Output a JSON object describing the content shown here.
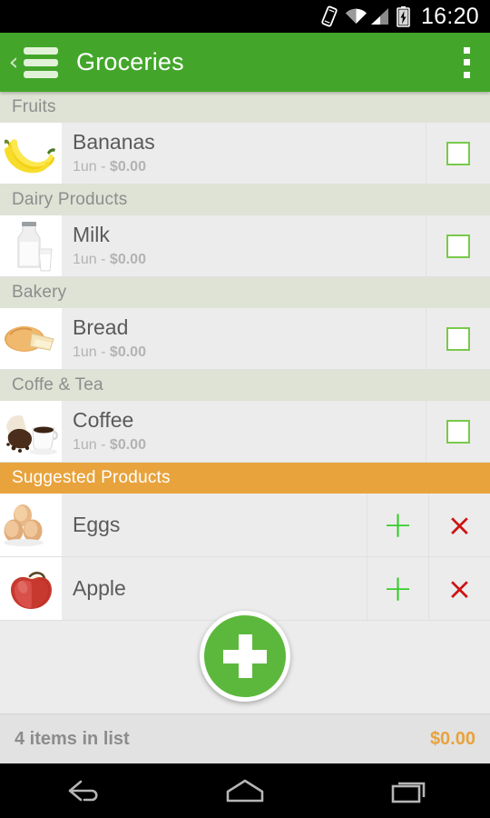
{
  "statusbar": {
    "time": "16:20",
    "icons": [
      "vibrate-icon",
      "wifi-icon",
      "signal-icon",
      "battery-charging-icon"
    ]
  },
  "toolbar": {
    "back_label": "‹",
    "title": "Groceries",
    "menu_icon": "overflow-menu-icon",
    "drawer_icon": "hamburger-icon",
    "bg_color": "#43a62b"
  },
  "list": {
    "sections": [
      {
        "category": "Fruits",
        "items": [
          {
            "name": "Bananas",
            "qty": "1un - ",
            "price": "$0.00",
            "checked": false,
            "image": "bananas"
          }
        ]
      },
      {
        "category": "Dairy Products",
        "items": [
          {
            "name": "Milk",
            "qty": "1un - ",
            "price": "$0.00",
            "checked": false,
            "image": "milk"
          }
        ]
      },
      {
        "category": "Bakery",
        "items": [
          {
            "name": "Bread",
            "qty": "1un - ",
            "price": "$0.00",
            "checked": false,
            "image": "bread"
          }
        ]
      },
      {
        "category": "Coffe & Tea",
        "items": [
          {
            "name": "Coffee",
            "qty": "1un - ",
            "price": "$0.00",
            "checked": false,
            "image": "coffee"
          }
        ]
      }
    ]
  },
  "suggested": {
    "header": "Suggested Products",
    "header_color": "#e8a33d",
    "add_glyph": "+",
    "remove_glyph": "×",
    "items": [
      {
        "name": "Eggs",
        "image": "eggs"
      },
      {
        "name": "Apple",
        "image": "apple"
      }
    ]
  },
  "fab": {
    "icon": "plus-icon",
    "color": "#5cb83c"
  },
  "footer": {
    "count_label": "4 items in list",
    "total": "$0.00",
    "total_color": "#e8a33d"
  },
  "navbar": {
    "buttons": [
      "back-nav-icon",
      "home-nav-icon",
      "recents-nav-icon"
    ]
  }
}
